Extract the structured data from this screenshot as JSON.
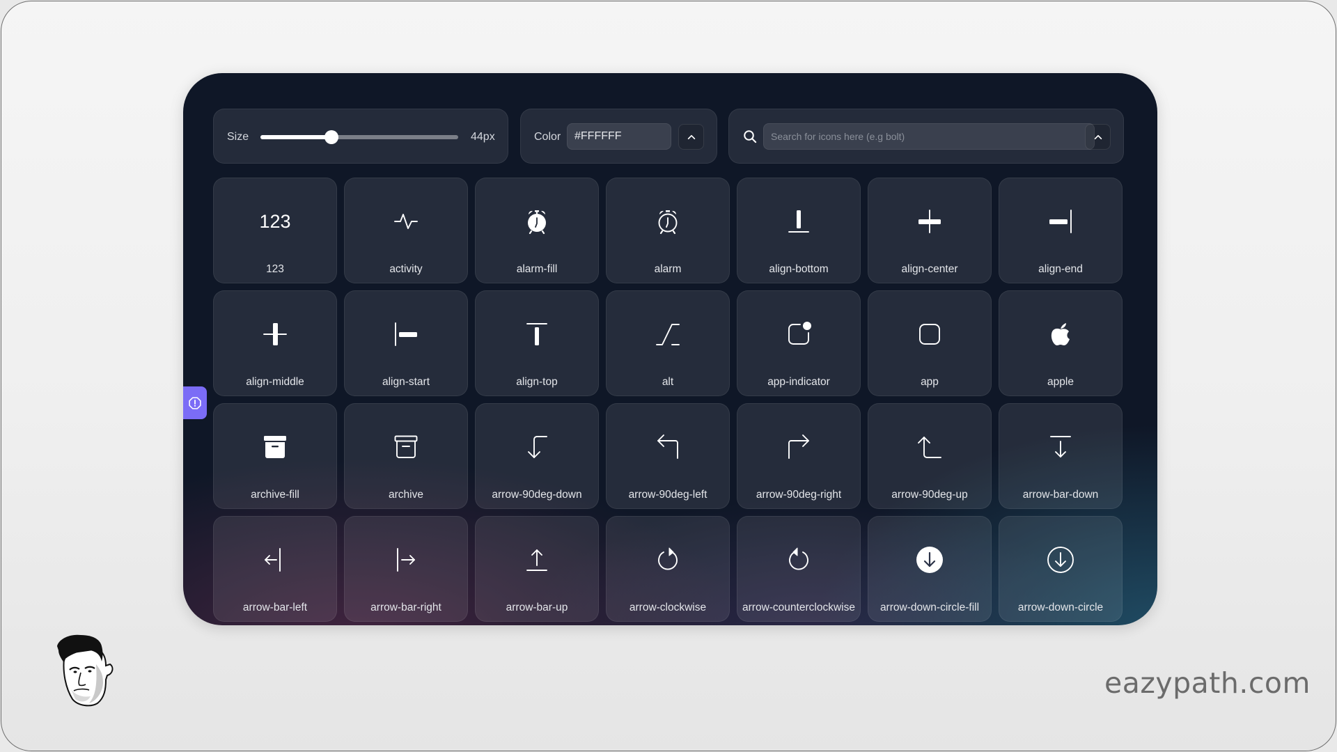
{
  "toolbar": {
    "size": {
      "label": "Size",
      "value_label": "44px",
      "value_fraction": 0.36
    },
    "color": {
      "label": "Color",
      "value": "#FFFFFF",
      "toggle_icon": "chevron-up-icon"
    },
    "search": {
      "icon": "search-icon",
      "placeholder": "Search for icons here (e.g bolt)",
      "value": "",
      "toggle_icon": "chevron-up-icon"
    }
  },
  "icons": [
    {
      "name": "123",
      "icon": "123-icon"
    },
    {
      "name": "activity",
      "icon": "activity-icon"
    },
    {
      "name": "alarm-fill",
      "icon": "alarm-fill-icon"
    },
    {
      "name": "alarm",
      "icon": "alarm-icon"
    },
    {
      "name": "align-bottom",
      "icon": "align-bottom-icon"
    },
    {
      "name": "align-center",
      "icon": "align-center-icon"
    },
    {
      "name": "align-end",
      "icon": "align-end-icon"
    },
    {
      "name": "align-middle",
      "icon": "align-middle-icon"
    },
    {
      "name": "align-start",
      "icon": "align-start-icon"
    },
    {
      "name": "align-top",
      "icon": "align-top-icon"
    },
    {
      "name": "alt",
      "icon": "alt-icon"
    },
    {
      "name": "app-indicator",
      "icon": "app-indicator-icon"
    },
    {
      "name": "app",
      "icon": "app-icon"
    },
    {
      "name": "apple",
      "icon": "apple-icon"
    },
    {
      "name": "archive-fill",
      "icon": "archive-fill-icon"
    },
    {
      "name": "archive",
      "icon": "archive-icon"
    },
    {
      "name": "arrow-90deg-down",
      "icon": "arrow-90deg-down-icon"
    },
    {
      "name": "arrow-90deg-left",
      "icon": "arrow-90deg-left-icon"
    },
    {
      "name": "arrow-90deg-right",
      "icon": "arrow-90deg-right-icon"
    },
    {
      "name": "arrow-90deg-up",
      "icon": "arrow-90deg-up-icon"
    },
    {
      "name": "arrow-bar-down",
      "icon": "arrow-bar-down-icon"
    },
    {
      "name": "arrow-bar-left",
      "icon": "arrow-bar-left-icon"
    },
    {
      "name": "arrow-bar-right",
      "icon": "arrow-bar-right-icon"
    },
    {
      "name": "arrow-bar-up",
      "icon": "arrow-bar-up-icon"
    },
    {
      "name": "arrow-clockwise",
      "icon": "arrow-clockwise-icon"
    },
    {
      "name": "arrow-counterclockwise",
      "icon": "arrow-counterclockwise-icon"
    },
    {
      "name": "arrow-down-circle-fill",
      "icon": "arrow-down-circle-fill-icon"
    },
    {
      "name": "arrow-down-circle",
      "icon": "arrow-down-circle-icon"
    }
  ],
  "feedback_tab": {
    "icon": "exclamation-octagon-icon"
  },
  "watermark": {
    "text": "eazypath.com",
    "avatar": "avatar-illustration"
  },
  "colors": {
    "accent": "#7B6CF6",
    "panel_bg": "#0F1727",
    "icon_color": "#FFFFFF"
  }
}
